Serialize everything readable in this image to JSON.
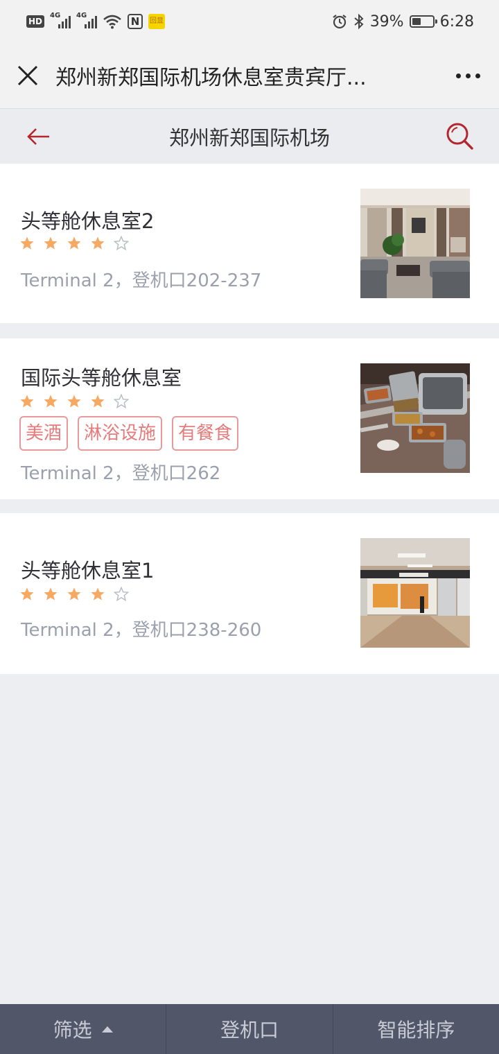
{
  "status_bar": {
    "hd": "HD",
    "net1": "4G",
    "net2": "4G",
    "nfc": "N",
    "badge": "回显",
    "battery": "39%",
    "time": "6:28"
  },
  "titlebar": {
    "title": "郑州新郑国际机场休息室贵宾厅..."
  },
  "header": {
    "title": "郑州新郑国际机场"
  },
  "lounges": [
    {
      "name": "头等舱休息室2",
      "rating": 4,
      "max_rating": 5,
      "tags": [],
      "location": "Terminal 2，登机口202-237",
      "image": "lounge-seating-photo"
    },
    {
      "name": "国际头等舱休息室",
      "rating": 4,
      "max_rating": 5,
      "tags": [
        "美酒",
        "淋浴设施",
        "有餐食"
      ],
      "location": "Terminal 2，登机口262",
      "image": "buffet-food-photo"
    },
    {
      "name": "头等舱休息室1",
      "rating": 4,
      "max_rating": 5,
      "tags": [],
      "location": "Terminal 2，登机口238-260",
      "image": "lounge-entrance-photo"
    }
  ],
  "bottom_bar": {
    "filter": "筛选",
    "gate": "登机口",
    "sort": "智能排序"
  },
  "colors": {
    "accent_red": "#b3262e",
    "star_filled": "#f6a962",
    "tag_red": "#e57b7b",
    "bottom_bar": "#515668"
  }
}
